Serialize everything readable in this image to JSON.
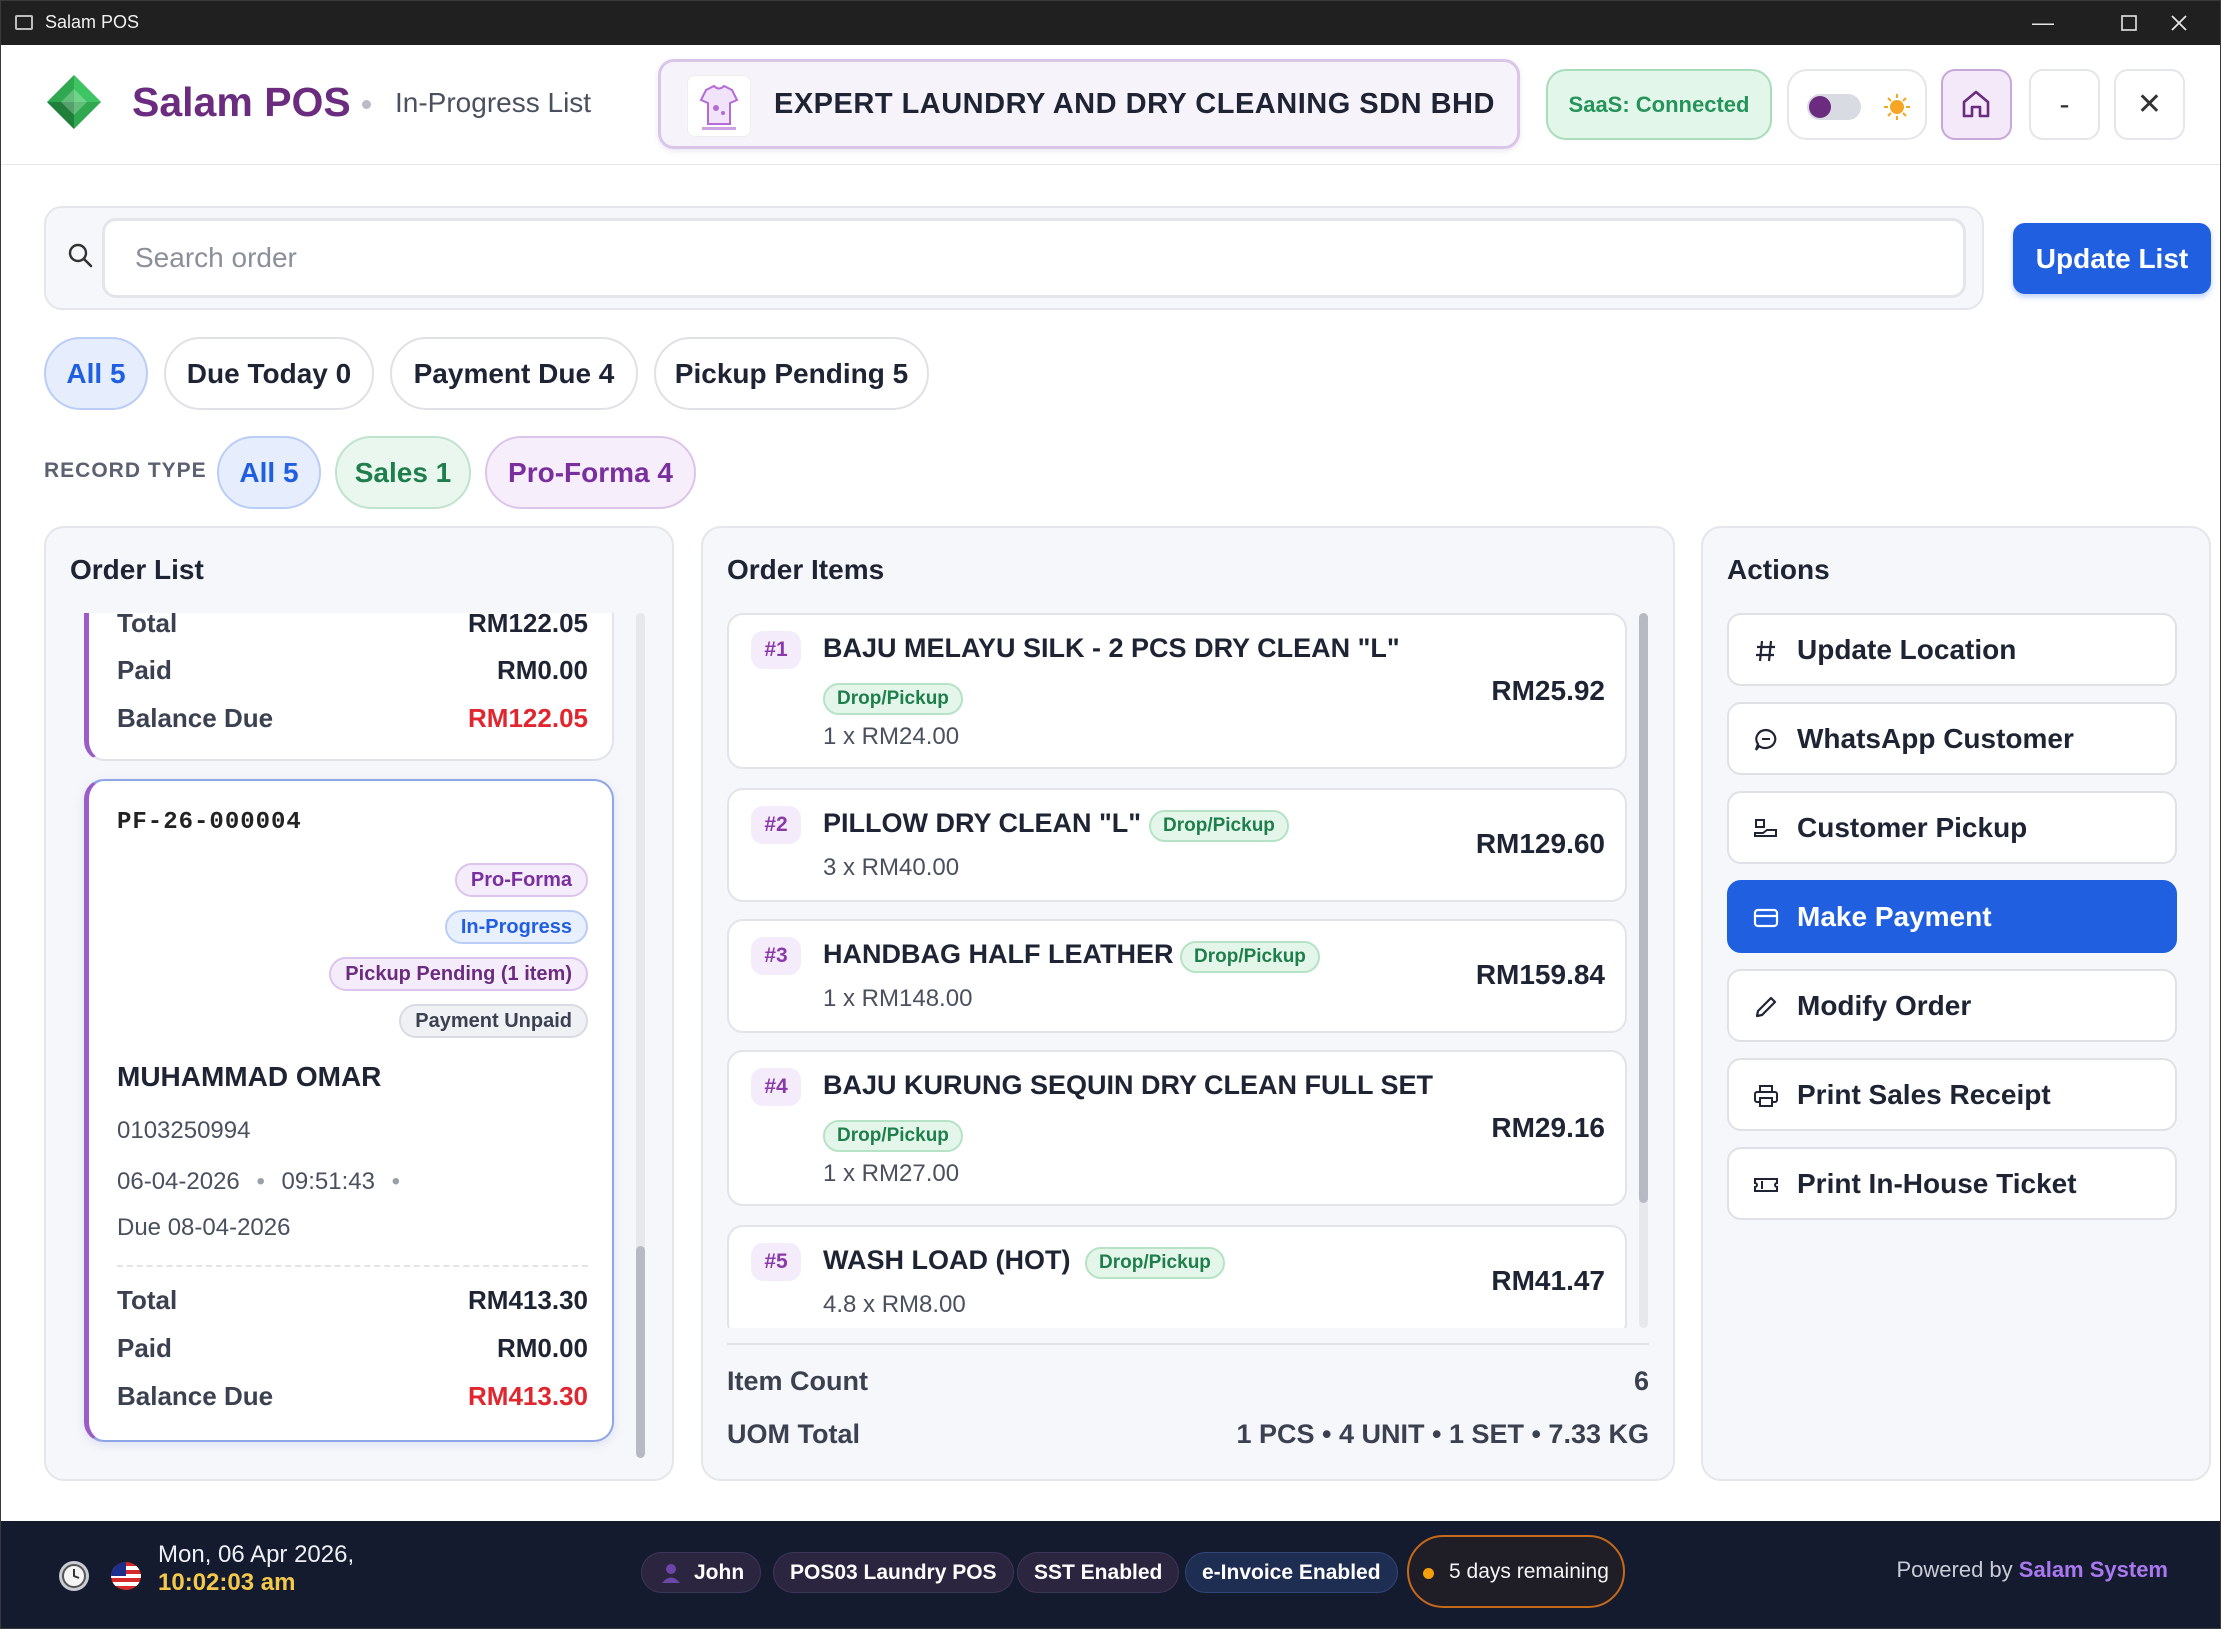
{
  "window": {
    "title": "Salam POS",
    "controls": [
      "—",
      "☐",
      "✕"
    ]
  },
  "header": {
    "brand": "Salam POS",
    "subtitle": "In-Progress List",
    "company": "EXPERT LAUNDRY AND DRY CLEANING SDN BHD",
    "saas_status": "SaaS: Connected",
    "minimize_label": "-",
    "close_label": "✕",
    "colors": {
      "brand": "#6b2c7f",
      "accent": "#1f5fe0",
      "success": "#24945a",
      "danger": "#e0262f"
    }
  },
  "search": {
    "placeholder": "Search order",
    "value": "",
    "update_label": "Update List"
  },
  "filters": [
    {
      "label": "All 5",
      "active": true
    },
    {
      "label": "Due Today 0",
      "active": false
    },
    {
      "label": "Payment Due 4",
      "active": false
    },
    {
      "label": "Pickup Pending 5",
      "active": false
    }
  ],
  "record_type": {
    "label": "RECORD TYPE",
    "options": [
      {
        "label": "All 5",
        "active": true
      },
      {
        "label": "Sales 1",
        "active": false
      },
      {
        "label": "Pro-Forma 4",
        "active": false
      }
    ]
  },
  "order_list": {
    "title": "Order List",
    "partial_order": {
      "total_label": "Total",
      "total": "RM122.05",
      "paid_label": "Paid",
      "paid": "RM0.00",
      "balance_label": "Balance Due",
      "balance": "RM122.05"
    },
    "selected_order": {
      "number": "PF-26-000004",
      "tags": [
        "Pro-Forma",
        "In-Progress",
        "Pickup Pending (1 item)",
        "Payment Unpaid"
      ],
      "customer": "MUHAMMAD OMAR",
      "phone": "0103250994",
      "date": "06-04-2026",
      "time": "09:51:43",
      "due": "Due 08-04-2026",
      "total_label": "Total",
      "total": "RM413.30",
      "paid_label": "Paid",
      "paid": "RM0.00",
      "balance_label": "Balance Due",
      "balance": "RM413.30"
    }
  },
  "order_items": {
    "title": "Order Items",
    "items": [
      {
        "num": "#1",
        "name": "BAJU MELAYU SILK - 2 PCS DRY CLEAN \"L\"",
        "tag": "Drop/Pickup",
        "qty": "1 x RM24.00",
        "price": "RM25.92"
      },
      {
        "num": "#2",
        "name": "PILLOW DRY CLEAN \"L\"",
        "tag": "Drop/Pickup",
        "qty": "3 x RM40.00",
        "price": "RM129.60"
      },
      {
        "num": "#3",
        "name": "HANDBAG HALF LEATHER",
        "tag": "Drop/Pickup",
        "qty": "1 x RM148.00",
        "price": "RM159.84"
      },
      {
        "num": "#4",
        "name": "BAJU KURUNG SEQUIN DRY CLEAN FULL SET",
        "tag": "Drop/Pickup",
        "qty": "1 x RM27.00",
        "price": "RM29.16"
      },
      {
        "num": "#5",
        "name": "WASH LOAD (HOT)",
        "tag": "Drop/Pickup",
        "qty": "4.8 x RM8.00",
        "price": "RM41.47"
      }
    ],
    "item_count_label": "Item Count",
    "item_count": "6",
    "uom_label": "UOM Total",
    "uom_total": "1 PCS • 4 UNIT • 1 SET • 7.33 KG"
  },
  "actions": {
    "title": "Actions",
    "buttons": [
      {
        "label": "Update Location",
        "icon": "hash-icon"
      },
      {
        "label": "WhatsApp Customer",
        "icon": "chat-icon"
      },
      {
        "label": "Customer Pickup",
        "icon": "pickup-icon"
      },
      {
        "label": "Make Payment",
        "icon": "card-icon"
      },
      {
        "label": "Modify Order",
        "icon": "pencil-icon"
      },
      {
        "label": "Print Sales Receipt",
        "icon": "printer-icon"
      },
      {
        "label": "Print In-House Ticket",
        "icon": "ticket-icon"
      }
    ]
  },
  "footer": {
    "date": "Mon, 06 Apr 2026,",
    "time": "10:02:03 am",
    "user": "John",
    "terminal": "POS03 Laundry POS",
    "sst": "SST Enabled",
    "einvoice": "e-Invoice Enabled",
    "days_remaining": "5 days remaining",
    "powered_prefix": "Powered by",
    "powered_brand": "Salam System"
  }
}
